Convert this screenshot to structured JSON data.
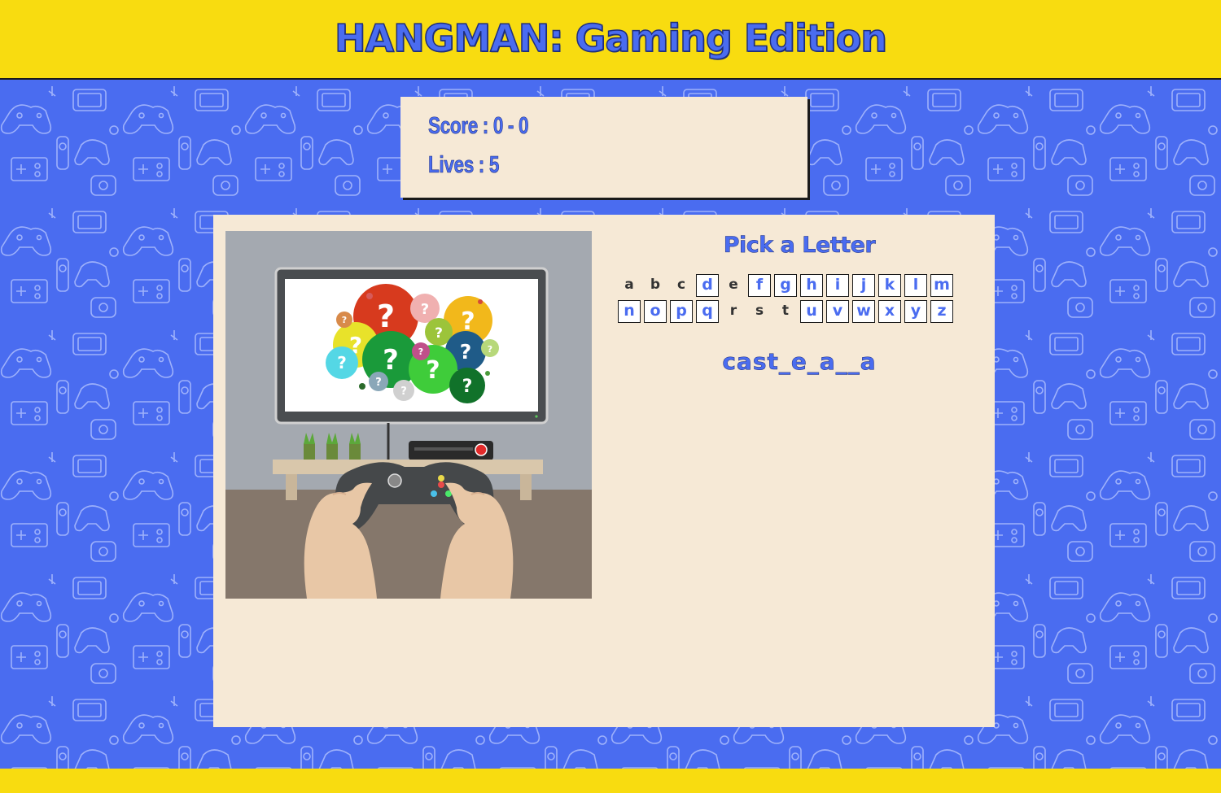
{
  "header": {
    "title": "HANGMAN: Gaming Edition"
  },
  "stats": {
    "score": "Score : 0 - 0",
    "lives": "Lives : 5"
  },
  "game": {
    "pick_title": "Pick a Letter",
    "letters_row1": [
      {
        "letter": "a",
        "used": true
      },
      {
        "letter": "b",
        "used": true
      },
      {
        "letter": "c",
        "used": true
      },
      {
        "letter": "d",
        "used": false
      },
      {
        "letter": "e",
        "used": true
      },
      {
        "letter": "f",
        "used": false
      },
      {
        "letter": "g",
        "used": false
      },
      {
        "letter": "h",
        "used": false
      },
      {
        "letter": "i",
        "used": false
      },
      {
        "letter": "j",
        "used": false
      },
      {
        "letter": "k",
        "used": false
      },
      {
        "letter": "l",
        "used": false
      },
      {
        "letter": "m",
        "used": false
      }
    ],
    "letters_row2": [
      {
        "letter": "n",
        "used": false
      },
      {
        "letter": "o",
        "used": false
      },
      {
        "letter": "p",
        "used": false
      },
      {
        "letter": "q",
        "used": false
      },
      {
        "letter": "r",
        "used": true
      },
      {
        "letter": "s",
        "used": true
      },
      {
        "letter": "t",
        "used": true
      },
      {
        "letter": "u",
        "used": false
      },
      {
        "letter": "v",
        "used": false
      },
      {
        "letter": "w",
        "used": false
      },
      {
        "letter": "x",
        "used": false
      },
      {
        "letter": "y",
        "used": false
      },
      {
        "letter": "z",
        "used": false
      }
    ],
    "word": "cast_e_a__a"
  },
  "colors": {
    "accent": "#4a6cf0",
    "banner": "#f8dc10",
    "panel": "#f6e9d6"
  }
}
